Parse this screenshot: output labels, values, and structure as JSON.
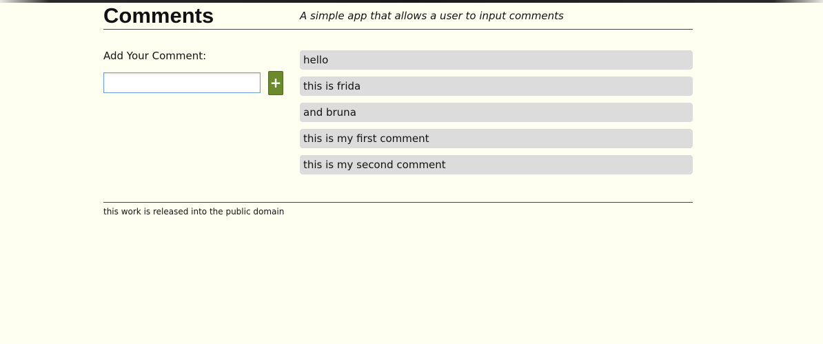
{
  "header": {
    "title": "Comments",
    "tagline": "A simple app that allows a user to input comments"
  },
  "form": {
    "label": "Add Your Comment:",
    "input_value": "",
    "add_button_label": "+"
  },
  "comments": [
    {
      "text": "hello"
    },
    {
      "text": "this is frida"
    },
    {
      "text": "and bruna"
    },
    {
      "text": "this is my first comment"
    },
    {
      "text": "this is my second comment"
    }
  ],
  "footer": {
    "text": "this work is released into the public domain"
  },
  "colors": {
    "background": "#fefff0",
    "comment_bg": "#dcdcdc",
    "button_bg": "#6b8a2c",
    "input_border": "#6a9fe0"
  }
}
